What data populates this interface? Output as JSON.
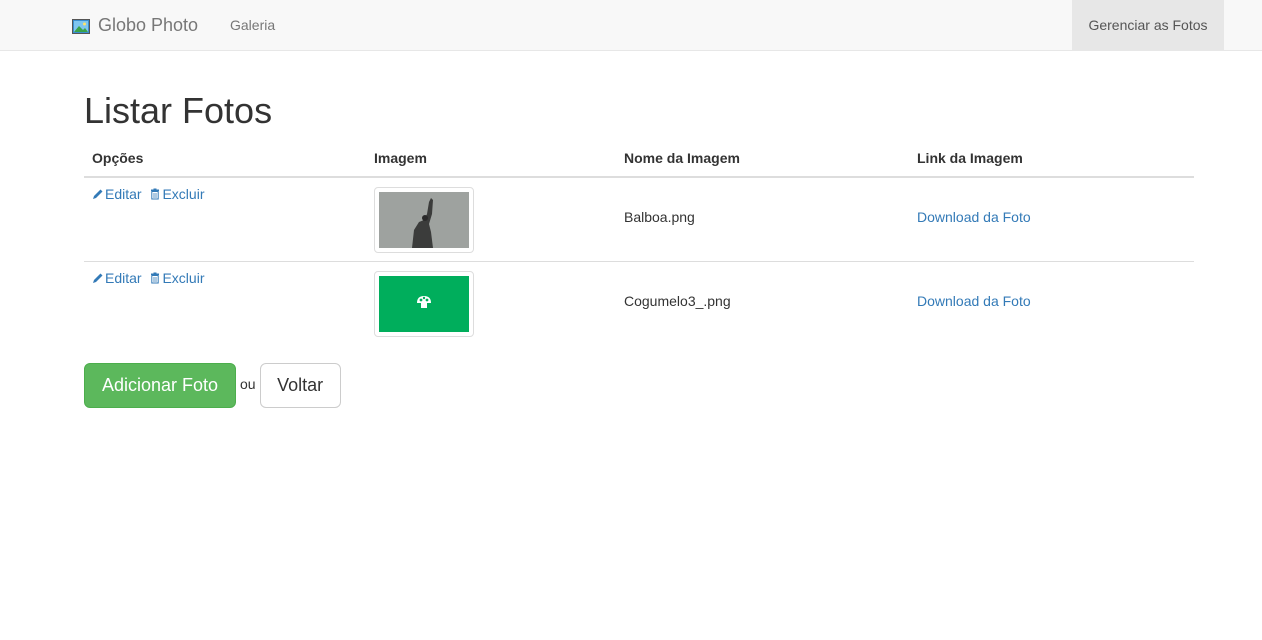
{
  "navbar": {
    "brand": "Globo Photo",
    "brand_icon": "photo-icon",
    "links": {
      "galeria": "Galeria"
    },
    "right_link": "Gerenciar as Fotos"
  },
  "page": {
    "title": "Listar Fotos"
  },
  "table": {
    "headers": {
      "opcoes": "Opções",
      "imagem": "Imagem",
      "nome": "Nome da Imagem",
      "link": "Link da Imagem"
    },
    "rows": [
      {
        "edit_label": "Editar",
        "delete_label": "Excluir",
        "image_name": "Balboa.png",
        "link_label": "Download da Foto"
      },
      {
        "edit_label": "Editar",
        "delete_label": "Excluir",
        "image_name": "Cogumelo3_.png",
        "link_label": "Download da Foto"
      }
    ]
  },
  "actions": {
    "add_label": "Adicionar Foto",
    "or_label": "ou",
    "back_label": "Voltar"
  },
  "colors": {
    "link": "#337ab7",
    "success": "#5cb85c",
    "navbar_bg": "#f8f8f8"
  },
  "icons": {
    "edit": "pencil-icon",
    "delete": "trash-icon"
  }
}
